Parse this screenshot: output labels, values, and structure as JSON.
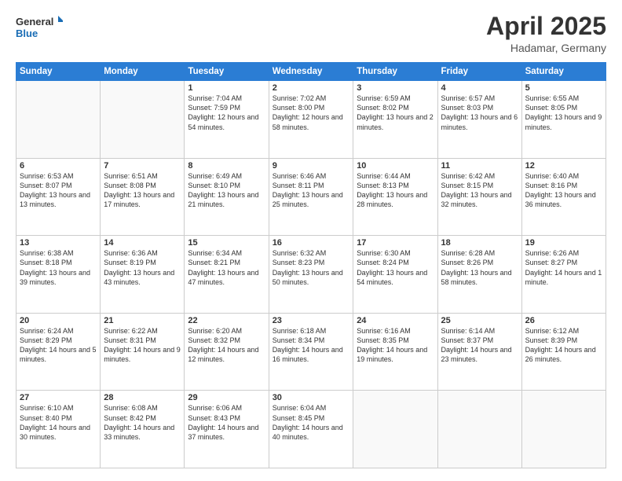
{
  "header": {
    "logo_line1": "General",
    "logo_line2": "Blue",
    "month_title": "April 2025",
    "location": "Hadamar, Germany"
  },
  "days_of_week": [
    "Sunday",
    "Monday",
    "Tuesday",
    "Wednesday",
    "Thursday",
    "Friday",
    "Saturday"
  ],
  "weeks": [
    [
      {
        "day": "",
        "info": ""
      },
      {
        "day": "",
        "info": ""
      },
      {
        "day": "1",
        "info": "Sunrise: 7:04 AM\nSunset: 7:59 PM\nDaylight: 12 hours and 54 minutes."
      },
      {
        "day": "2",
        "info": "Sunrise: 7:02 AM\nSunset: 8:00 PM\nDaylight: 12 hours and 58 minutes."
      },
      {
        "day": "3",
        "info": "Sunrise: 6:59 AM\nSunset: 8:02 PM\nDaylight: 13 hours and 2 minutes."
      },
      {
        "day": "4",
        "info": "Sunrise: 6:57 AM\nSunset: 8:03 PM\nDaylight: 13 hours and 6 minutes."
      },
      {
        "day": "5",
        "info": "Sunrise: 6:55 AM\nSunset: 8:05 PM\nDaylight: 13 hours and 9 minutes."
      }
    ],
    [
      {
        "day": "6",
        "info": "Sunrise: 6:53 AM\nSunset: 8:07 PM\nDaylight: 13 hours and 13 minutes."
      },
      {
        "day": "7",
        "info": "Sunrise: 6:51 AM\nSunset: 8:08 PM\nDaylight: 13 hours and 17 minutes."
      },
      {
        "day": "8",
        "info": "Sunrise: 6:49 AM\nSunset: 8:10 PM\nDaylight: 13 hours and 21 minutes."
      },
      {
        "day": "9",
        "info": "Sunrise: 6:46 AM\nSunset: 8:11 PM\nDaylight: 13 hours and 25 minutes."
      },
      {
        "day": "10",
        "info": "Sunrise: 6:44 AM\nSunset: 8:13 PM\nDaylight: 13 hours and 28 minutes."
      },
      {
        "day": "11",
        "info": "Sunrise: 6:42 AM\nSunset: 8:15 PM\nDaylight: 13 hours and 32 minutes."
      },
      {
        "day": "12",
        "info": "Sunrise: 6:40 AM\nSunset: 8:16 PM\nDaylight: 13 hours and 36 minutes."
      }
    ],
    [
      {
        "day": "13",
        "info": "Sunrise: 6:38 AM\nSunset: 8:18 PM\nDaylight: 13 hours and 39 minutes."
      },
      {
        "day": "14",
        "info": "Sunrise: 6:36 AM\nSunset: 8:19 PM\nDaylight: 13 hours and 43 minutes."
      },
      {
        "day": "15",
        "info": "Sunrise: 6:34 AM\nSunset: 8:21 PM\nDaylight: 13 hours and 47 minutes."
      },
      {
        "day": "16",
        "info": "Sunrise: 6:32 AM\nSunset: 8:23 PM\nDaylight: 13 hours and 50 minutes."
      },
      {
        "day": "17",
        "info": "Sunrise: 6:30 AM\nSunset: 8:24 PM\nDaylight: 13 hours and 54 minutes."
      },
      {
        "day": "18",
        "info": "Sunrise: 6:28 AM\nSunset: 8:26 PM\nDaylight: 13 hours and 58 minutes."
      },
      {
        "day": "19",
        "info": "Sunrise: 6:26 AM\nSunset: 8:27 PM\nDaylight: 14 hours and 1 minute."
      }
    ],
    [
      {
        "day": "20",
        "info": "Sunrise: 6:24 AM\nSunset: 8:29 PM\nDaylight: 14 hours and 5 minutes."
      },
      {
        "day": "21",
        "info": "Sunrise: 6:22 AM\nSunset: 8:31 PM\nDaylight: 14 hours and 9 minutes."
      },
      {
        "day": "22",
        "info": "Sunrise: 6:20 AM\nSunset: 8:32 PM\nDaylight: 14 hours and 12 minutes."
      },
      {
        "day": "23",
        "info": "Sunrise: 6:18 AM\nSunset: 8:34 PM\nDaylight: 14 hours and 16 minutes."
      },
      {
        "day": "24",
        "info": "Sunrise: 6:16 AM\nSunset: 8:35 PM\nDaylight: 14 hours and 19 minutes."
      },
      {
        "day": "25",
        "info": "Sunrise: 6:14 AM\nSunset: 8:37 PM\nDaylight: 14 hours and 23 minutes."
      },
      {
        "day": "26",
        "info": "Sunrise: 6:12 AM\nSunset: 8:39 PM\nDaylight: 14 hours and 26 minutes."
      }
    ],
    [
      {
        "day": "27",
        "info": "Sunrise: 6:10 AM\nSunset: 8:40 PM\nDaylight: 14 hours and 30 minutes."
      },
      {
        "day": "28",
        "info": "Sunrise: 6:08 AM\nSunset: 8:42 PM\nDaylight: 14 hours and 33 minutes."
      },
      {
        "day": "29",
        "info": "Sunrise: 6:06 AM\nSunset: 8:43 PM\nDaylight: 14 hours and 37 minutes."
      },
      {
        "day": "30",
        "info": "Sunrise: 6:04 AM\nSunset: 8:45 PM\nDaylight: 14 hours and 40 minutes."
      },
      {
        "day": "",
        "info": ""
      },
      {
        "day": "",
        "info": ""
      },
      {
        "day": "",
        "info": ""
      }
    ]
  ]
}
